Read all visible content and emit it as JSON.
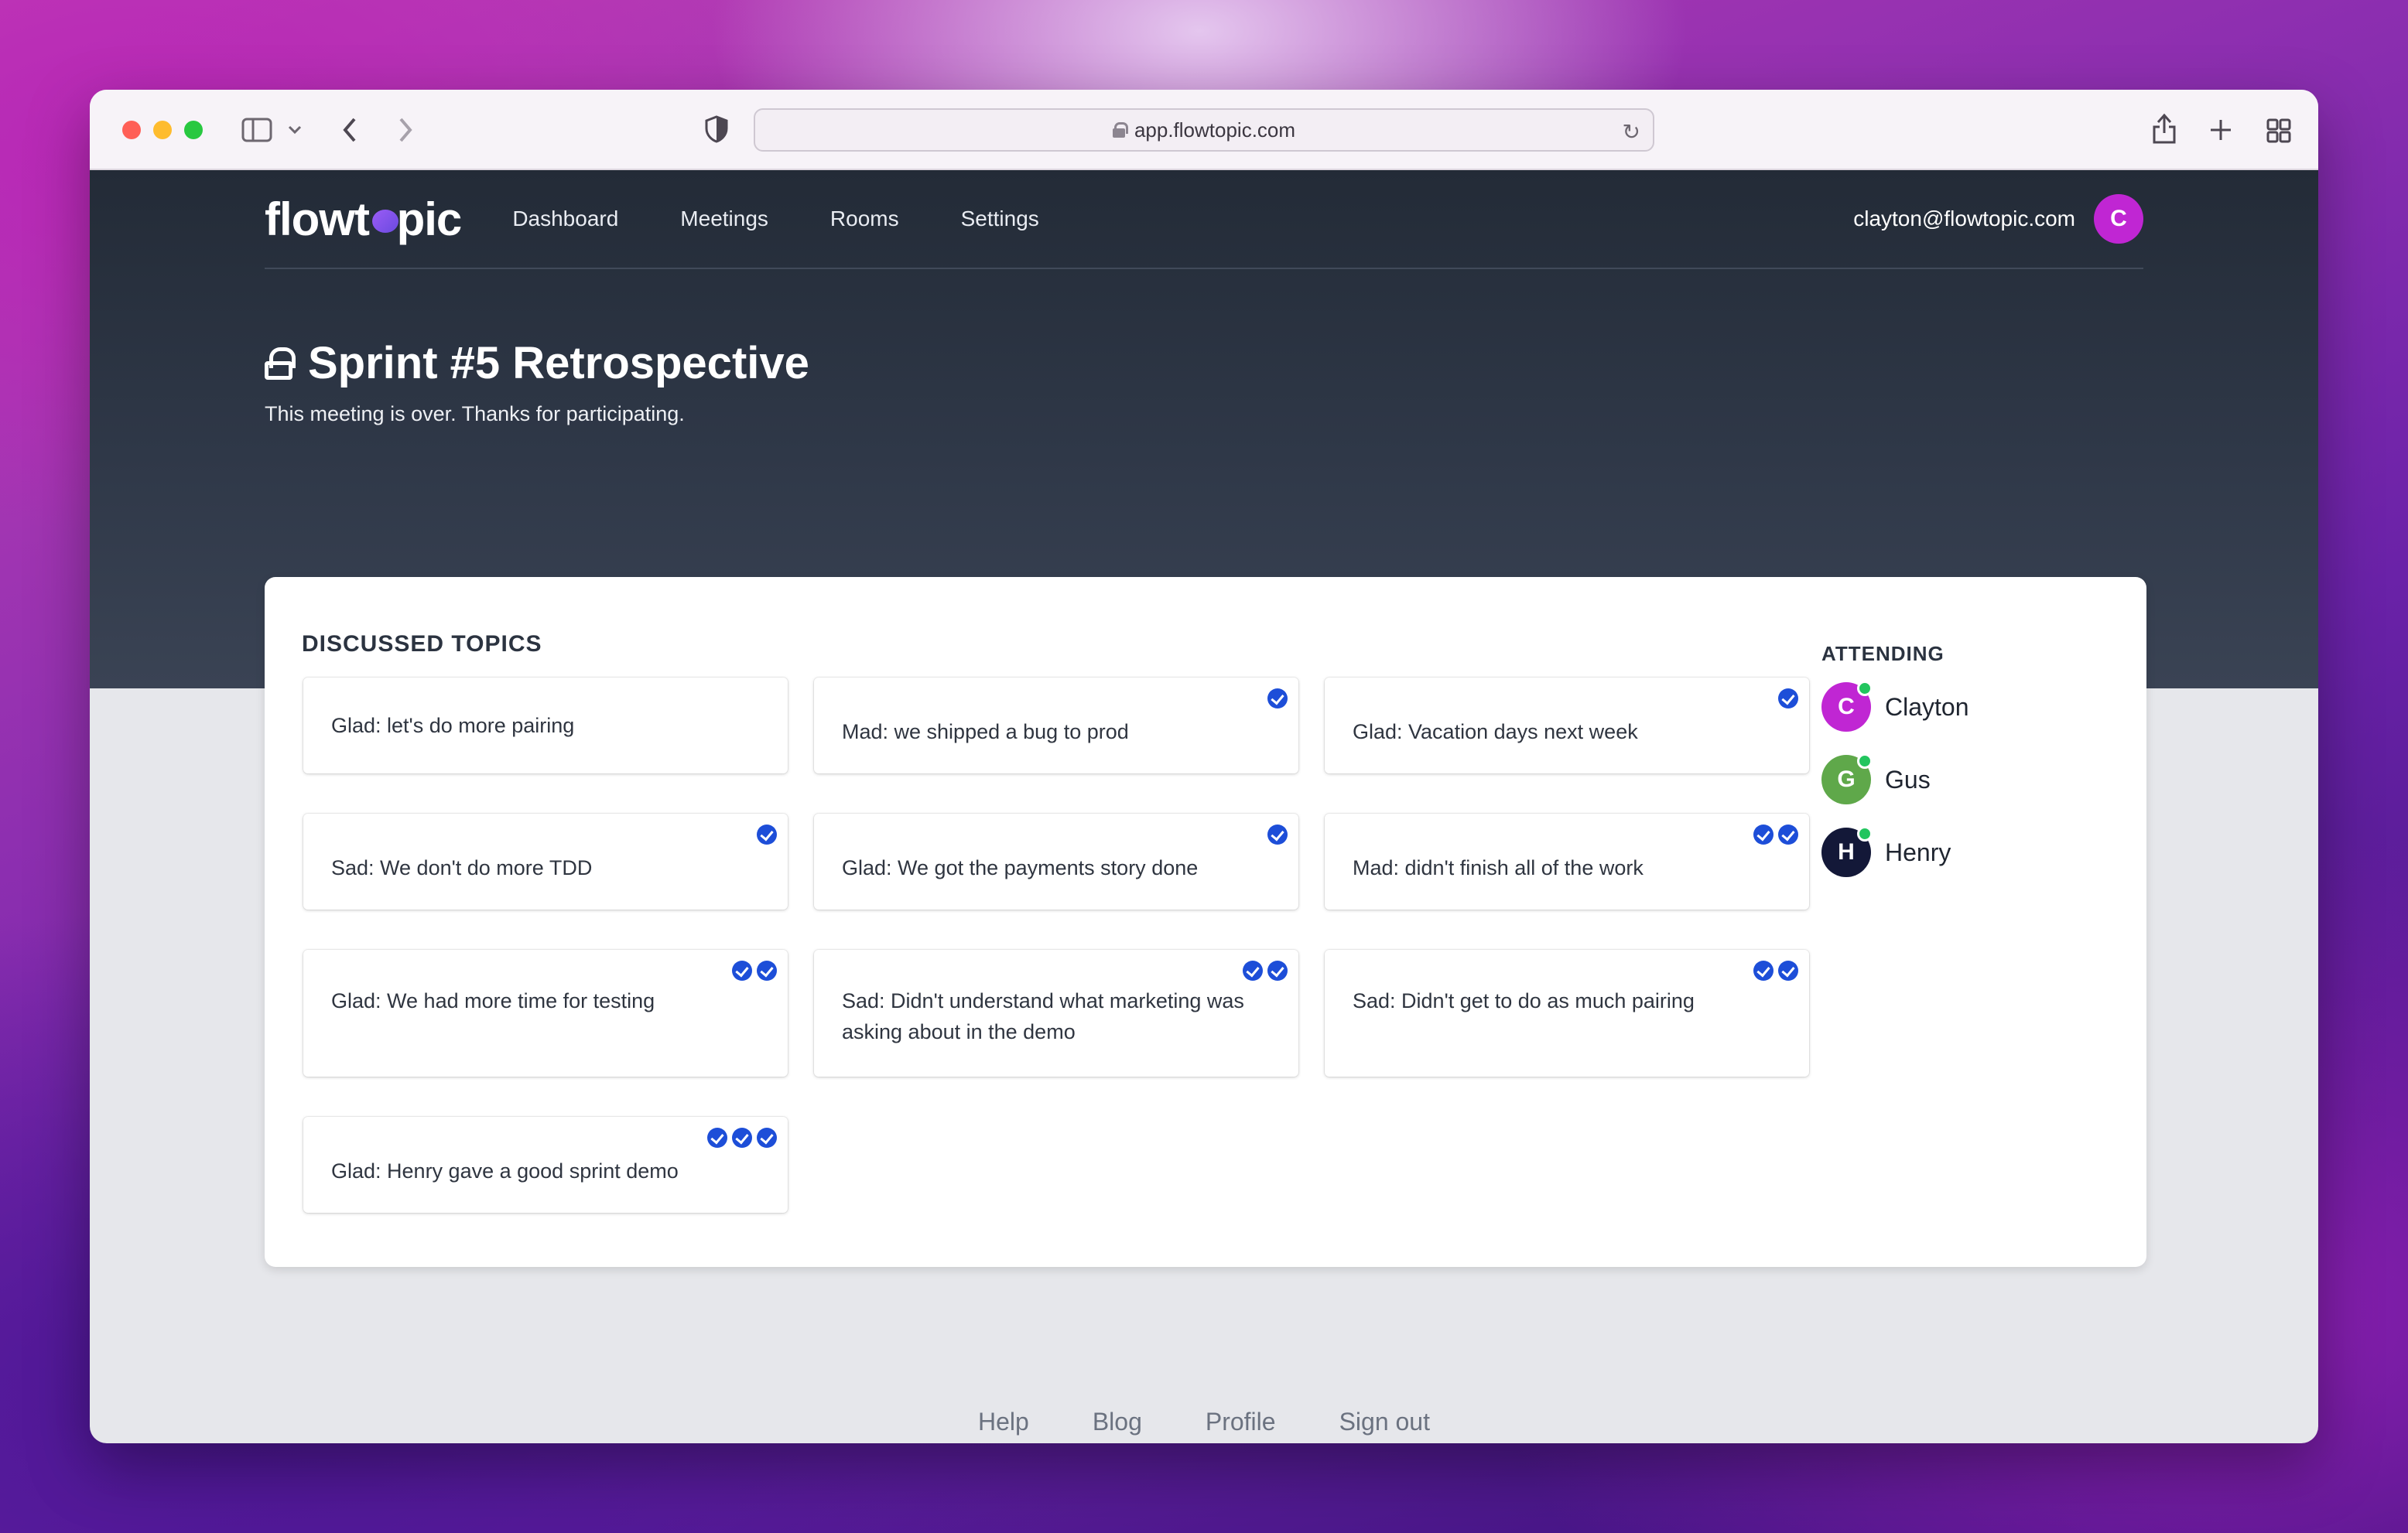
{
  "browser": {
    "url": "app.flowtopic.com"
  },
  "nav": {
    "logo": "flowtopic",
    "links": [
      "Dashboard",
      "Meetings",
      "Rooms",
      "Settings"
    ],
    "user_email": "clayton@flowtopic.com",
    "user_initial": "C"
  },
  "meeting": {
    "title": "Sprint #5 Retrospective",
    "status": "This meeting is over. Thanks for participating."
  },
  "topics": {
    "heading": "DISCUSSED TOPICS",
    "items": [
      {
        "text": "Glad: let's do more pairing",
        "votes": 0
      },
      {
        "text": "Mad: we shipped a bug to prod",
        "votes": 1
      },
      {
        "text": "Glad: Vacation days next week",
        "votes": 1
      },
      {
        "text": "Sad: We don't do more TDD",
        "votes": 1
      },
      {
        "text": "Glad: We got the payments story done",
        "votes": 1
      },
      {
        "text": "Mad: didn't finish all of the work",
        "votes": 2
      },
      {
        "text": "Glad: We had more time for testing",
        "votes": 2
      },
      {
        "text": "Sad: Didn't understand what marketing was asking about in the demo",
        "votes": 2
      },
      {
        "text": "Sad: Didn't get to do as much pairing",
        "votes": 2
      },
      {
        "text": "Glad: Henry gave a good sprint demo",
        "votes": 3
      }
    ]
  },
  "attending": {
    "heading": "ATTENDING",
    "people": [
      {
        "initial": "C",
        "name": "Clayton",
        "color": "#c026d3"
      },
      {
        "initial": "G",
        "name": "Gus",
        "color": "#5fa84a"
      },
      {
        "initial": "H",
        "name": "Henry",
        "color": "#131838"
      }
    ]
  },
  "footer": {
    "links": [
      "Help",
      "Blog",
      "Profile",
      "Sign out"
    ]
  },
  "colors": {
    "vote": "#1d4ed8",
    "online": "#22c55e",
    "hero": "#2f3848"
  }
}
